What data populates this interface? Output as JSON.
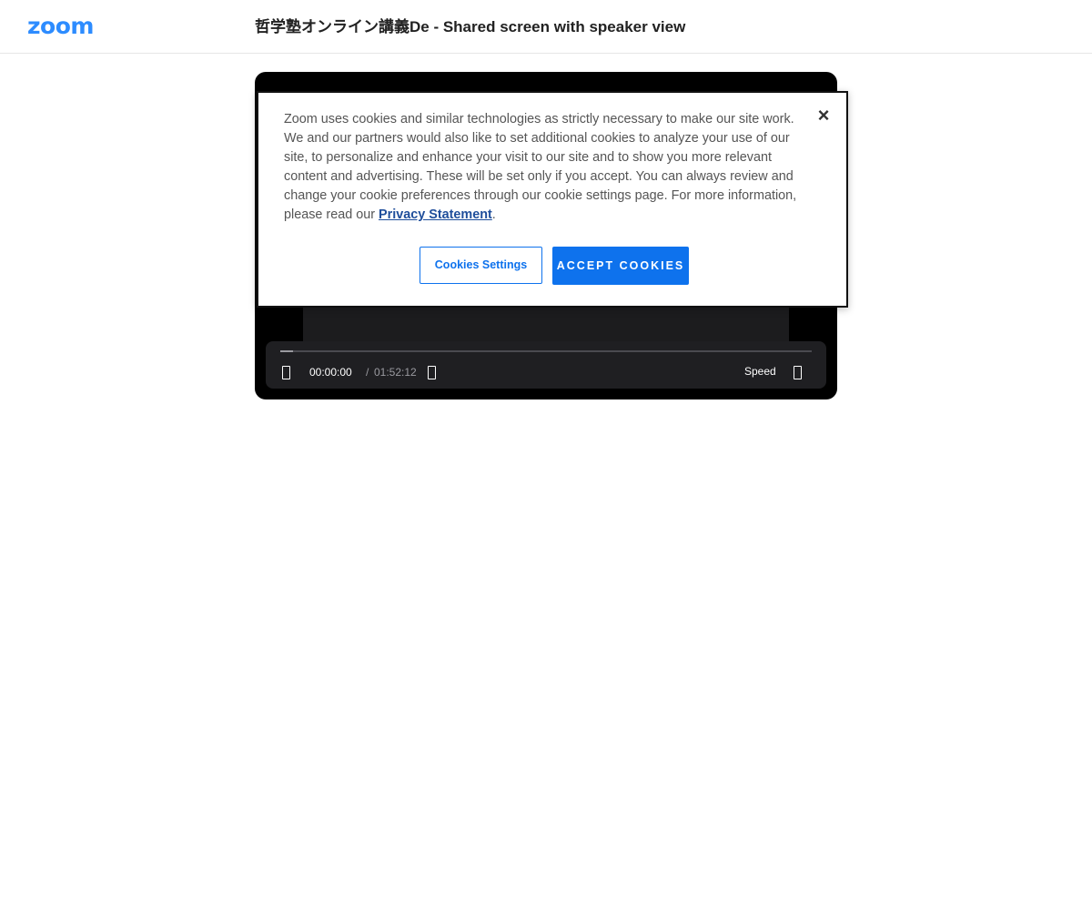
{
  "header": {
    "logo_text": "zoom",
    "title": "哲学塾オンライン講義De - Shared screen with speaker view"
  },
  "player": {
    "current_time": "00:00:00",
    "separator": "/",
    "total_time": "01:52:12",
    "speed_label": "Speed",
    "progress_fraction": 0.0
  },
  "cookie_banner": {
    "text": "Zoom uses cookies and similar technologies as strictly necessary to make our site work. We and our partners would also like to set additional cookies to analyze your use of our site, to personalize and enhance your visit to our site and to show you more relevant content and advertising. These will be set only if you accept. You can always review and change your cookie preferences through our cookie settings page. For more information, please read our",
    "privacy_link": "Privacy Statement",
    "period": ".",
    "close_glyph": "×",
    "settings_button": "Cookies Settings",
    "accept_button": "ACCEPT COOKIES"
  },
  "colors": {
    "brand_blue": "#2d8cff",
    "button_blue": "#0e72ed",
    "link_blue": "#1f4e9b",
    "player_bg": "#000000"
  },
  "icons": [
    "play-icon",
    "volume-icon",
    "fullscreen-icon",
    "close-icon"
  ]
}
